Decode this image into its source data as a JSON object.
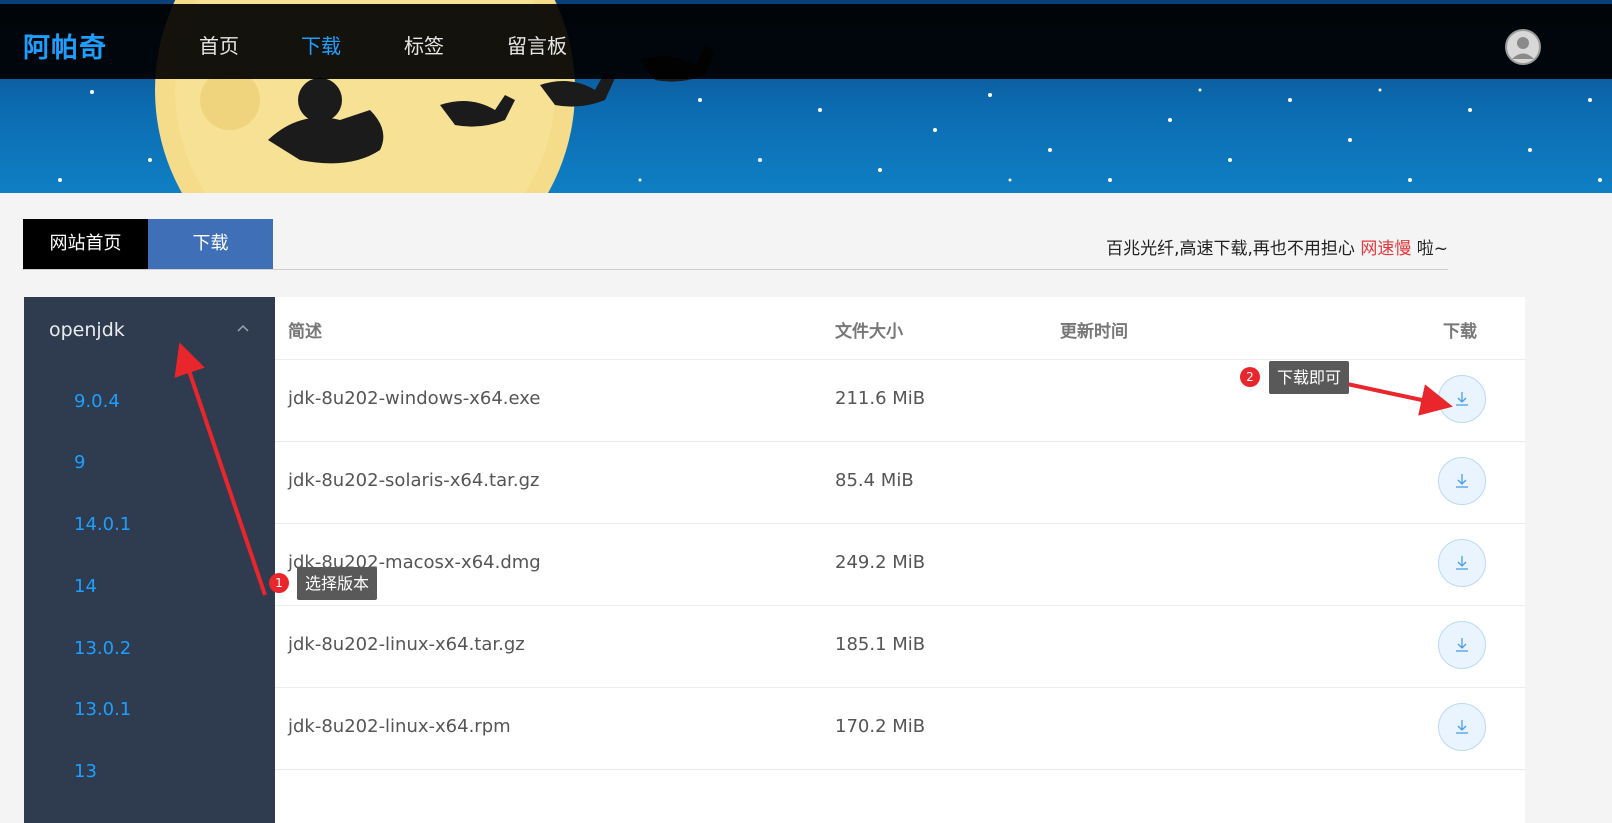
{
  "header": {
    "logo": "阿帕奇",
    "nav": [
      "首页",
      "下载",
      "标签",
      "留言板"
    ],
    "active_nav": "下载"
  },
  "tabs": {
    "home": "网站首页",
    "download": "下载"
  },
  "slogan": {
    "prefix": "百兆光纤,高速下载,再也不用担心",
    "highlight": "网速慢",
    "suffix": "啦~"
  },
  "sidebar": {
    "group": "openjdk",
    "items": [
      "9.0.4",
      "9",
      "14.0.1",
      "14",
      "13.0.2",
      "13.0.1",
      "13"
    ]
  },
  "table": {
    "columns": [
      "简述",
      "文件大小",
      "更新时间",
      "下载"
    ],
    "rows": [
      {
        "name": "jdk-8u202-windows-x64.exe",
        "size": "211.6 MiB",
        "updated": ""
      },
      {
        "name": "jdk-8u202-solaris-x64.tar.gz",
        "size": "85.4 MiB",
        "updated": ""
      },
      {
        "name": "jdk-8u202-macosx-x64.dmg",
        "size": "249.2 MiB",
        "updated": ""
      },
      {
        "name": "jdk-8u202-linux-x64.tar.gz",
        "size": "185.1 MiB",
        "updated": ""
      },
      {
        "name": "jdk-8u202-linux-x64.rpm",
        "size": "170.2 MiB",
        "updated": ""
      }
    ]
  },
  "annotations": [
    {
      "number": "1",
      "text": "选择版本"
    },
    {
      "number": "2",
      "text": "下载即可"
    }
  ],
  "colors": {
    "accent": "#1e9fff",
    "tab_active": "#3f6fb6",
    "sidebar_bg": "#2f3c4f",
    "annotation_red": "#e8262b"
  }
}
